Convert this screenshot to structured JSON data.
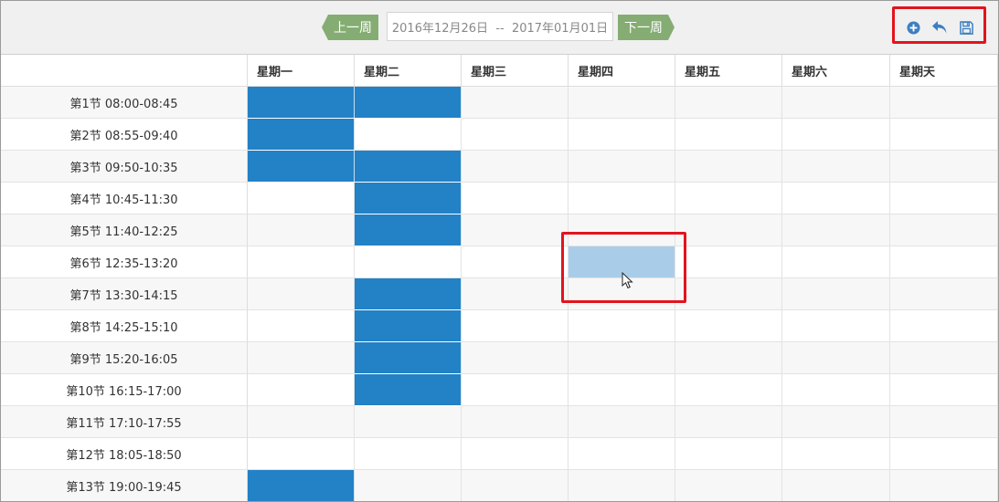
{
  "toolbar": {
    "prev_label": "上一周",
    "next_label": "下一周",
    "date_range": "2016年12月26日  --  2017年01月01日",
    "icons": [
      "add-circle-icon",
      "undo-icon",
      "save-icon"
    ],
    "accent_green": "#85ad73",
    "icon_color": "#3c7fc1",
    "highlight_color": "#e3131d"
  },
  "schedule": {
    "days": [
      "星期一",
      "星期二",
      "星期三",
      "星期四",
      "星期五",
      "星期六",
      "星期天"
    ],
    "selected_color": "#2381c6",
    "hover_color": "#a9cde8",
    "periods": [
      {
        "label": "第1节 08:00-08:45",
        "selected": [
          true,
          true,
          false,
          false,
          false,
          false,
          false
        ]
      },
      {
        "label": "第2节 08:55-09:40",
        "selected": [
          true,
          false,
          false,
          false,
          false,
          false,
          false
        ]
      },
      {
        "label": "第3节 09:50-10:35",
        "selected": [
          true,
          true,
          false,
          false,
          false,
          false,
          false
        ]
      },
      {
        "label": "第4节 10:45-11:30",
        "selected": [
          false,
          true,
          false,
          false,
          false,
          false,
          false
        ]
      },
      {
        "label": "第5节 11:40-12:25",
        "selected": [
          false,
          true,
          false,
          false,
          false,
          false,
          false
        ]
      },
      {
        "label": "第6节 12:35-13:20",
        "selected": [
          false,
          false,
          false,
          false,
          false,
          false,
          false
        ],
        "hover_day": 3
      },
      {
        "label": "第7节 13:30-14:15",
        "selected": [
          false,
          true,
          false,
          false,
          false,
          false,
          false
        ]
      },
      {
        "label": "第8节 14:25-15:10",
        "selected": [
          false,
          true,
          false,
          false,
          false,
          false,
          false
        ]
      },
      {
        "label": "第9节 15:20-16:05",
        "selected": [
          false,
          true,
          false,
          false,
          false,
          false,
          false
        ]
      },
      {
        "label": "第10节 16:15-17:00",
        "selected": [
          false,
          true,
          false,
          false,
          false,
          false,
          false
        ]
      },
      {
        "label": "第11节 17:10-17:55",
        "selected": [
          false,
          false,
          false,
          false,
          false,
          false,
          false
        ]
      },
      {
        "label": "第12节 18:05-18:50",
        "selected": [
          false,
          false,
          false,
          false,
          false,
          false,
          false
        ]
      },
      {
        "label": "第13节 19:00-19:45",
        "selected": [
          true,
          false,
          false,
          false,
          false,
          false,
          false
        ]
      }
    ]
  }
}
